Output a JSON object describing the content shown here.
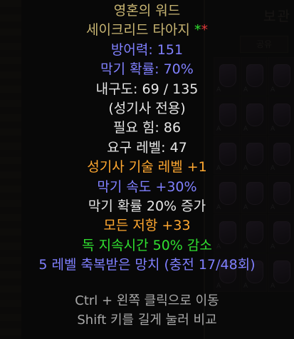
{
  "stash": {
    "title": "보관",
    "tab_label": "공유",
    "slot_mark": "A"
  },
  "tooltip": {
    "item_name": "영혼의 워드",
    "item_base": "세이크리드 타아지",
    "star_green": "*",
    "star_red": "*",
    "defense": "방어력: 151",
    "block_chance": "막기 확률: 70%",
    "durability": "내구도: 69 / 135",
    "class_only": "(성기사 전용)",
    "req_str": "필요 힘: 86",
    "req_level": "요구 레벨: 47",
    "mods": [
      {
        "text": "성기사 기술 레벨 +1",
        "color": "orange"
      },
      {
        "text": "막기 속도 +30%",
        "color": "blue"
      },
      {
        "text": "막기 확률 20% 증가",
        "color": "white"
      },
      {
        "text": "모든 저항 +33",
        "color": "orange"
      },
      {
        "text": "독 지속시간 50% 감소",
        "color": "green"
      },
      {
        "text": "5 레벨 축복받은 망치 (충전 17/48회)",
        "color": "blue"
      }
    ],
    "hint_move": "Ctrl + 왼쪽 클릭으로 이동",
    "hint_compare": "Shift 키를 길게 눌러 비교"
  },
  "colors": {
    "unique_gold": "#c8b572",
    "magic_blue": "#8080ff",
    "craft_orange": "#ffa830",
    "set_green": "#30e030"
  }
}
